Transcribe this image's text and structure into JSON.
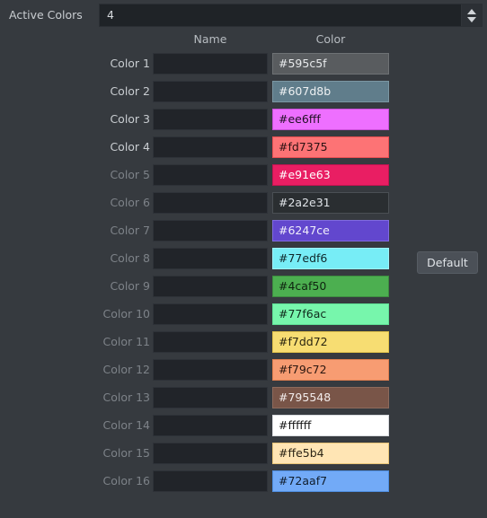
{
  "window": {
    "background": "#363a3f"
  },
  "active_colors": {
    "label": "Active Colors",
    "value": "4",
    "spin_up_icon": "triangle-up-icon",
    "spin_down_icon": "triangle-down-icon"
  },
  "headers": {
    "name": "Name",
    "color": "Color"
  },
  "buttons": {
    "default": "Default"
  },
  "rows": [
    {
      "label": "Color 1",
      "name": "",
      "color": "#595c5f",
      "text_color": "#e8eaec",
      "border": "#6e7174",
      "active": true
    },
    {
      "label": "Color 2",
      "name": "",
      "color": "#607d8b",
      "text_color": "#eef1f3",
      "border": "#7b97a3",
      "active": true
    },
    {
      "label": "Color 3",
      "name": "",
      "color": "#ee6fff",
      "text_color": "#201024",
      "border": "#c74fd6",
      "active": true
    },
    {
      "label": "Color 4",
      "name": "",
      "color": "#fd7375",
      "text_color": "#2a1112",
      "border": "#e84f52",
      "active": true
    },
    {
      "label": "Color 5",
      "name": "",
      "color": "#e91e63",
      "text_color": "#ffffff",
      "border": "#c01450",
      "active": false
    },
    {
      "label": "Color 6",
      "name": "",
      "color": "#2a2e31",
      "text_color": "#dfe3e7",
      "border": "#4a4f54",
      "active": false
    },
    {
      "label": "Color 7",
      "name": "",
      "color": "#6247ce",
      "text_color": "#f0eefb",
      "border": "#7f6ae0",
      "active": false
    },
    {
      "label": "Color 8",
      "name": "",
      "color": "#77edf6",
      "text_color": "#10282b",
      "border": "#9df4fa",
      "active": false
    },
    {
      "label": "Color 9",
      "name": "",
      "color": "#4caf50",
      "text_color": "#0f2410",
      "border": "#3d8c40",
      "active": false
    },
    {
      "label": "Color 10",
      "name": "",
      "color": "#77f6ac",
      "text_color": "#102a1c",
      "border": "#5fe096",
      "active": false
    },
    {
      "label": "Color 11",
      "name": "",
      "color": "#f7dd72",
      "text_color": "#2a2510",
      "border": "#e0c14a",
      "active": false
    },
    {
      "label": "Color 12",
      "name": "",
      "color": "#f79c72",
      "text_color": "#2b1710",
      "border": "#e07f4f",
      "active": false
    },
    {
      "label": "Color 13",
      "name": "",
      "color": "#795548",
      "text_color": "#f2eceb",
      "border": "#8d6a5c",
      "active": false
    },
    {
      "label": "Color 14",
      "name": "",
      "color": "#ffffff",
      "text_color": "#151515",
      "border": "#d8dade",
      "active": false
    },
    {
      "label": "Color 15",
      "name": "",
      "color": "#ffe5b4",
      "text_color": "#2b2415",
      "border": "#e8c477",
      "active": false
    },
    {
      "label": "Color 16",
      "name": "",
      "color": "#72aaf7",
      "text_color": "#101d2c",
      "border": "#4f8ee0",
      "active": false
    }
  ]
}
